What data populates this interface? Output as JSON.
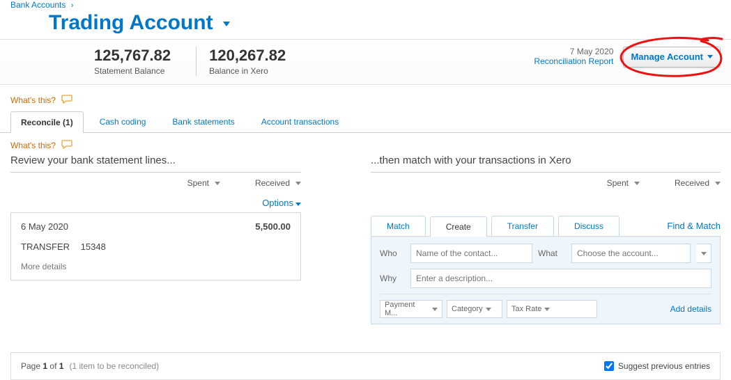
{
  "breadcrumb": {
    "parent": "Bank Accounts"
  },
  "title": "Trading Account",
  "balances": {
    "statement": {
      "amount": "125,767.82",
      "label": "Statement Balance"
    },
    "xero": {
      "amount": "120,267.82",
      "label": "Balance in Xero"
    }
  },
  "header_right": {
    "date": "7 May 2020",
    "recon_link": "Reconciliation Report",
    "manage_btn": "Manage Account"
  },
  "whats_this": "What's this?",
  "tabs": [
    {
      "label": "Reconcile (1)",
      "active": true
    },
    {
      "label": "Cash coding",
      "active": false
    },
    {
      "label": "Bank statements",
      "active": false
    },
    {
      "label": "Account transactions",
      "active": false
    }
  ],
  "left": {
    "heading": "Review your bank statement lines...",
    "spent": "Spent",
    "received": "Received",
    "options": "Options",
    "card": {
      "date": "6 May 2020",
      "amount": "5,500.00",
      "desc": "TRANSFER",
      "ref": "15348",
      "more": "More details"
    }
  },
  "right": {
    "heading": "...then match with your transactions in Xero",
    "spent": "Spent",
    "received": "Received",
    "mtabs": {
      "match": "Match",
      "create": "Create",
      "transfer": "Transfer",
      "discuss": "Discuss"
    },
    "find": "Find & Match",
    "form": {
      "who_label": "Who",
      "who_placeholder": "Name of the contact...",
      "what_label": "What",
      "what_placeholder": "Choose the account...",
      "why_label": "Why",
      "why_placeholder": "Enter a description...",
      "payment_m": "Payment M...",
      "category": "Category",
      "tax_rate": "Tax Rate",
      "add_details": "Add details"
    }
  },
  "footer": {
    "page_prefix": "Page",
    "page_cur": "1",
    "page_of": "of",
    "page_total": "1",
    "note": "(1 item to be reconciled)",
    "suggest": "Suggest previous entries"
  }
}
